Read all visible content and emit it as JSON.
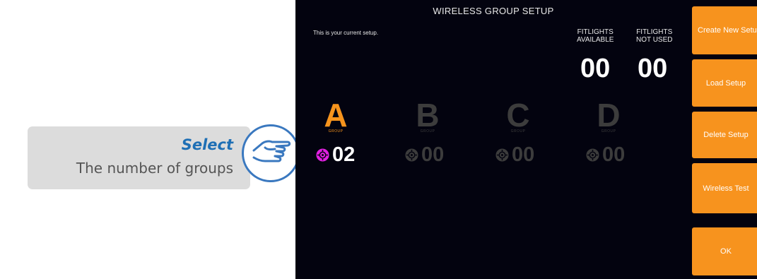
{
  "callout": {
    "select_label": "Select",
    "description": "The number of groups"
  },
  "screen": {
    "title": "WIRELESS GROUP SETUP",
    "current_setup_text": "This is your current setup.",
    "available": {
      "header_line1": "FITLIGHTS",
      "header_line2": "AVAILABLE",
      "value": "00"
    },
    "not_used": {
      "header_line1": "FITLIGHTS",
      "header_line2": "NOT USED",
      "value": "00"
    },
    "groups": [
      {
        "letter": "A",
        "sub": "GROUP",
        "count": "02",
        "active": true
      },
      {
        "letter": "B",
        "sub": "GROUP",
        "count": "00",
        "active": false
      },
      {
        "letter": "C",
        "sub": "GROUP",
        "count": "00",
        "active": false
      },
      {
        "letter": "D",
        "sub": "GROUP",
        "count": "00",
        "active": false
      }
    ]
  },
  "buttons": {
    "create_new_setup": "Create New Setup",
    "load_setup": "Load Setup",
    "delete_setup": "Delete Setup",
    "wireless_test": "Wireless Test",
    "ok": "OK"
  },
  "colors": {
    "accent_orange": "#f7931e",
    "active_gear": "#e020e0",
    "inactive": "#3c3c3c",
    "screen_bg": "#03030f",
    "callout_blue": "#1e6fb5"
  }
}
